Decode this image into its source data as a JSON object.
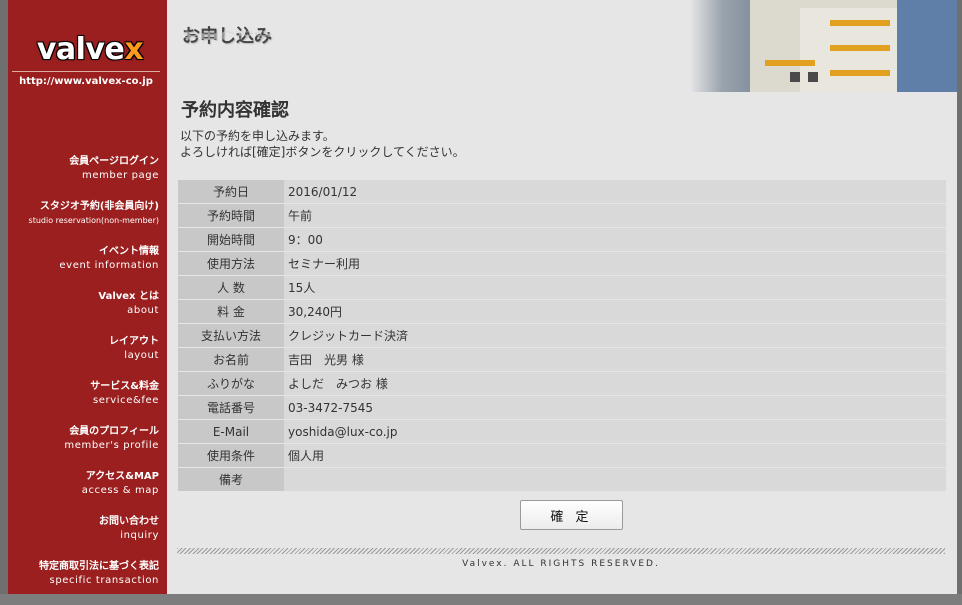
{
  "brand": {
    "logo_main": "valve",
    "logo_x": "x",
    "url": "http://www.valvex-co.jp"
  },
  "sidebar": {
    "items": [
      {
        "ja": "会員ページログイン",
        "en": "member page"
      },
      {
        "ja": "スタジオ予約(非会員向け)",
        "en": "studio reservation(non-member)"
      },
      {
        "ja": "イベント情報",
        "en": "event information"
      },
      {
        "ja": "Valvex とは",
        "en": "about"
      },
      {
        "ja": "レイアウト",
        "en": "layout"
      },
      {
        "ja": "サービス&料金",
        "en": "service&fee"
      },
      {
        "ja": "会員のプロフィール",
        "en": "member's profile"
      },
      {
        "ja": "アクセス&MAP",
        "en": "access & map"
      },
      {
        "ja": "お問い合わせ",
        "en": "inquiry"
      },
      {
        "ja": "特定商取引法に基づく表記",
        "en": "specific transaction"
      }
    ]
  },
  "header": {
    "title": "お申し込み"
  },
  "main": {
    "title": "予約内容確認",
    "intro_line1": "以下の予約を申し込みます。",
    "intro_line2": "よろしければ[確定]ボタンをクリックしてください。",
    "rows": [
      {
        "label": "予約日",
        "value": "2016/01/12"
      },
      {
        "label": "予約時間",
        "value": "午前"
      },
      {
        "label": "開始時間",
        "value": "9：00"
      },
      {
        "label": "使用方法",
        "value": "セミナー利用"
      },
      {
        "label": "人 数",
        "value": "15人"
      },
      {
        "label": "料 金",
        "value": "30,240円"
      },
      {
        "label": "支払い方法",
        "value": "クレジットカード決済"
      },
      {
        "label": "お名前",
        "value": "吉田　光男 様"
      },
      {
        "label": "ふりがな",
        "value": "よしだ　みつお 様"
      },
      {
        "label": "電話番号",
        "value": "03-3472-7545"
      },
      {
        "label": "E-Mail",
        "value": "yoshida@lux-co.jp"
      },
      {
        "label": "使用条件",
        "value": "個人用"
      },
      {
        "label": "備考",
        "value": ""
      }
    ],
    "confirm_label": "確 定"
  },
  "footer": {
    "text": "Valvex. ALL RIGHTS RESERVED."
  },
  "colors": {
    "sidebar": "#9b1f1f",
    "accent": "#ff9a1a",
    "content_bg": "#e6e6e6"
  }
}
